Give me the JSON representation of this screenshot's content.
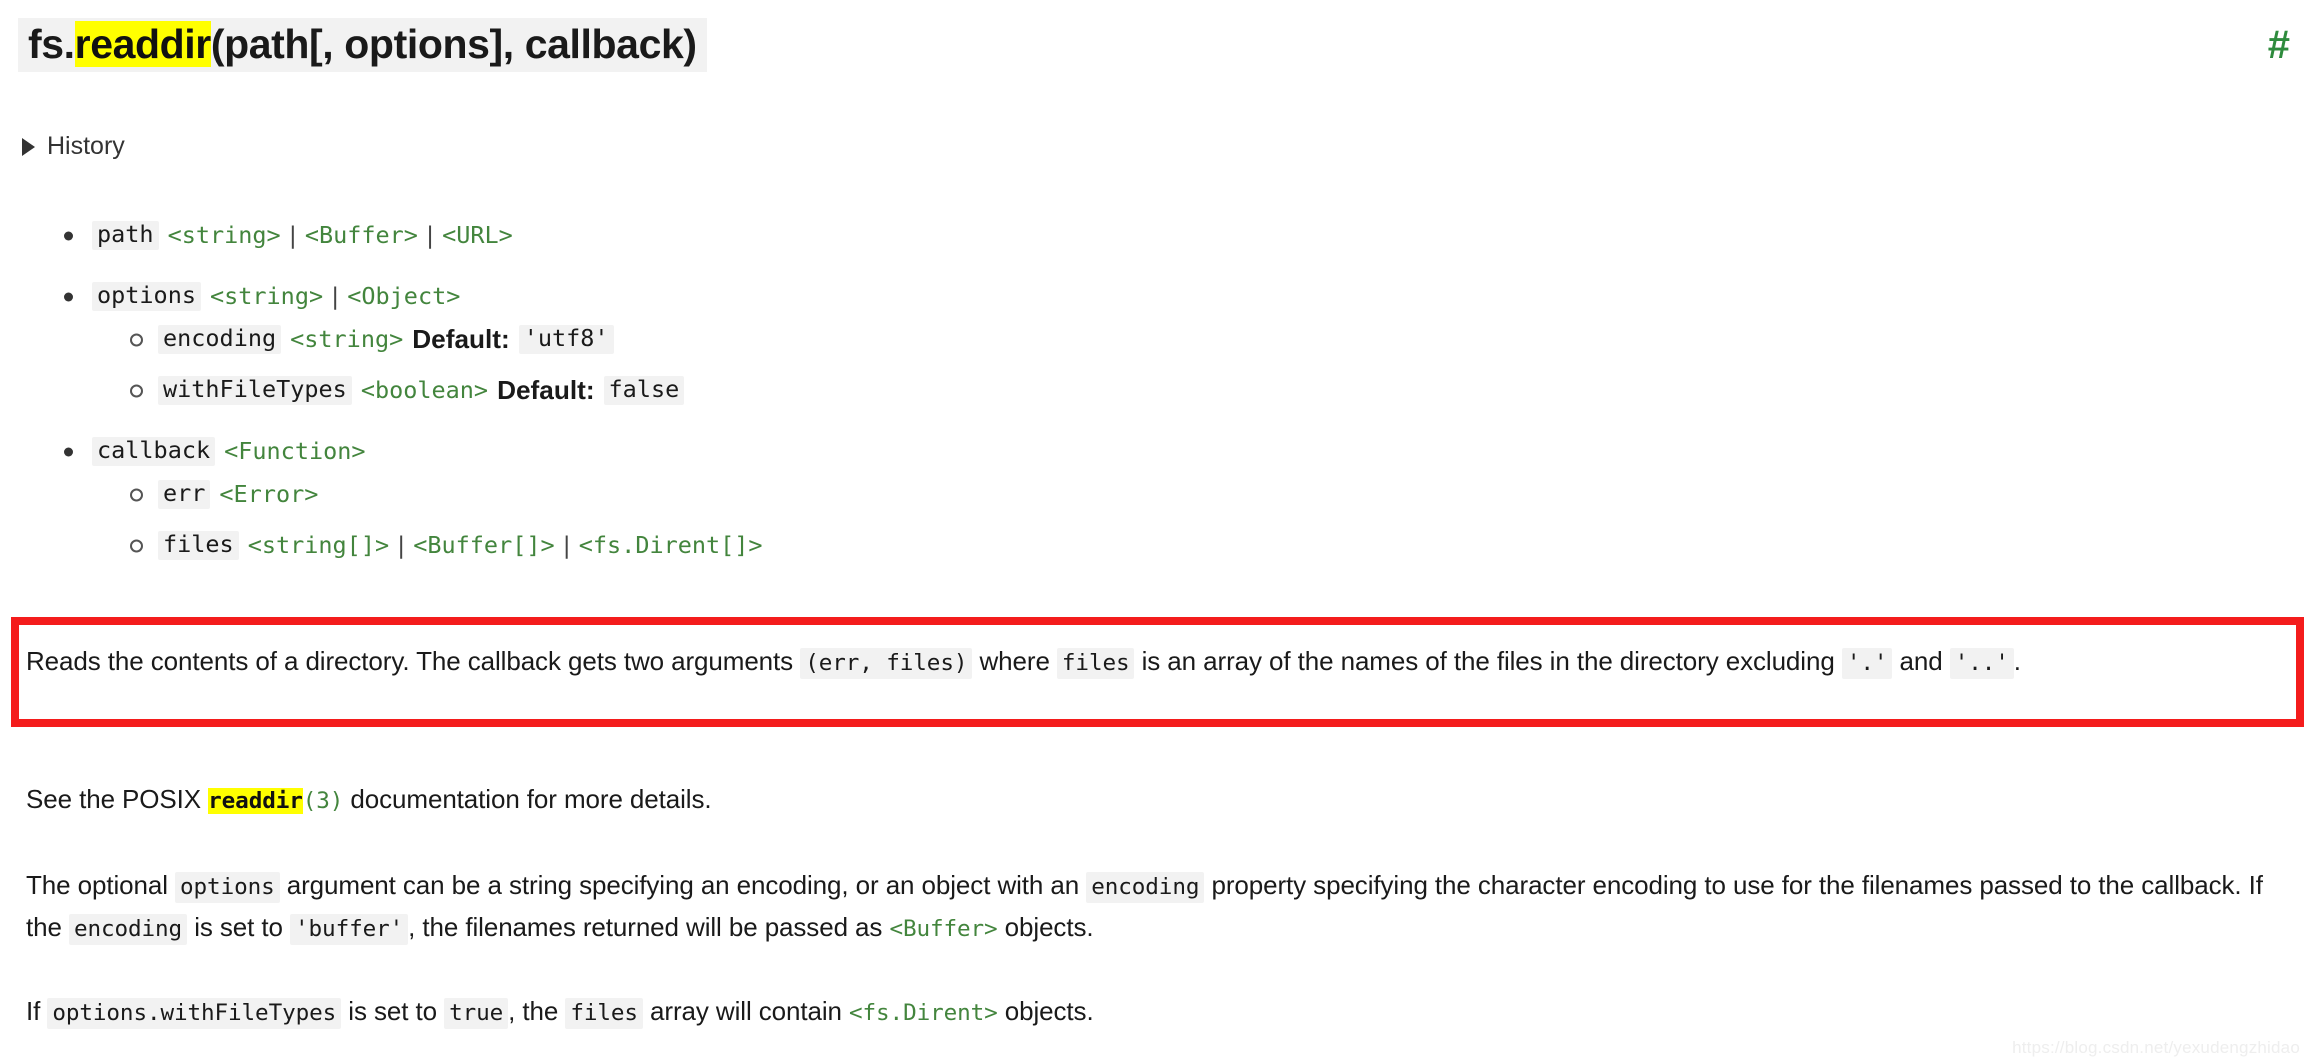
{
  "heading": {
    "prefix": "fs.",
    "highlight": "readdir",
    "suffix": "(path[, options], callback)",
    "anchor_symbol": "#",
    "anchor_name": "anchor-link"
  },
  "history": {
    "label": "History",
    "expanded": false,
    "marker": "▶"
  },
  "params": [
    {
      "name": "path",
      "types": [
        "<string>",
        "<Buffer>",
        "<URL>"
      ],
      "separator": "|",
      "children": []
    },
    {
      "name": "options",
      "types": [
        "<string>",
        "<Object>"
      ],
      "separator": "|",
      "children": [
        {
          "name": "encoding",
          "types": [
            "<string>"
          ],
          "default_label": "Default:",
          "default_value": "'utf8'"
        },
        {
          "name": "withFileTypes",
          "types": [
            "<boolean>"
          ],
          "default_label": "Default:",
          "default_value": "false"
        }
      ]
    },
    {
      "name": "callback",
      "types": [
        "<Function>"
      ],
      "separator": "|",
      "children": [
        {
          "name": "err",
          "types": [
            "<Error>"
          ]
        },
        {
          "name": "files",
          "types": [
            "<string[]>",
            "<Buffer[]>",
            "<fs.Dirent[]>"
          ],
          "separator": "|"
        }
      ]
    }
  ],
  "paragraphs": {
    "description": {
      "t1": "Reads the contents of a directory. The callback gets two arguments ",
      "c1": "(err, files)",
      "t2": " where ",
      "c2": "files",
      "t3": " is an array of the names of the files in the directory excluding ",
      "c3": "'.'",
      "t4": " and ",
      "c4": "'..'",
      "t5": "."
    },
    "posix": {
      "t1": "See the POSIX ",
      "link_highlight": "readdir",
      "link_suffix": "(3)",
      "t2": " documentation for more details."
    },
    "options_para": {
      "t1": "The optional ",
      "c1": "options",
      "t2": " argument can be a string specifying an encoding, or an object with an ",
      "c2": "encoding",
      "t3": " property specifying the character encoding to use for the filenames passed to the callback. If the ",
      "c3": "encoding",
      "t4": " is set to ",
      "c4": "'buffer'",
      "t5": ", the filenames returned will be passed as ",
      "type1": "<Buffer>",
      "t6": " objects."
    },
    "dirent_para": {
      "t1": "If ",
      "c1": "options.withFileTypes",
      "t2": " is set to ",
      "c2": "true",
      "t3": ", the ",
      "c3": "files",
      "t4": " array will contain ",
      "type1": "<fs.Dirent>",
      "t5": " objects."
    }
  },
  "annotation": {
    "type": "red-rectangle-highlight",
    "color": "#f41c1c",
    "target": "description-paragraph"
  },
  "watermark": {
    "text": "https://blog.csdn.net/yexudengzhidao"
  },
  "colors": {
    "type_link_green": "#43853d",
    "anchor_green": "#2e8b3d",
    "code_background": "#f2f2f2",
    "search_highlight": "#ffff00",
    "annotation_red": "#f41c1c",
    "text": "#1a1a1a"
  }
}
